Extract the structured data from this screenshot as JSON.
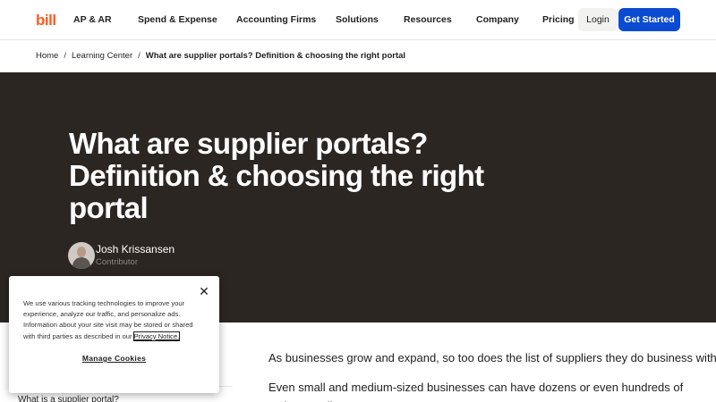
{
  "nav": {
    "logo": "bill",
    "links": [
      "AP & AR",
      "Spend & Expense",
      "Accounting Firms",
      "Solutions",
      "Resources",
      "Company",
      "Pricing"
    ],
    "login": "Login",
    "get_started": "Get Started"
  },
  "breadcrumb": {
    "home": "Home",
    "learning_center": "Learning Center",
    "current": "What are supplier portals? Definition & choosing the right portal",
    "separator": "/"
  },
  "hero": {
    "title": "What are supplier portals? Definition & choosing the right portal",
    "author_name": "Josh Krissansen",
    "author_role": "Contributor",
    "background": "#2c2623"
  },
  "article": {
    "p1": "As businesses grow and expand, so too does the list of suppliers they do business with.",
    "p2": "Even small and medium-sized businesses can have dozens or even hundreds of active suppliers."
  },
  "toc": {
    "first_item": "What is a supplier portal?"
  },
  "cookie_banner": {
    "text_before_link": "We use various tracking technologies to improve your experience, analyze our traffic, and personalize ads. Information about your site visit may be stored or shared with third parties as described in our ",
    "link_text": "Privacy Notice.",
    "manage": "Manage Cookies",
    "close_icon": "close-icon"
  },
  "colors": {
    "brand_orange": "#ff5a1f",
    "primary_blue": "#0b4bd1"
  }
}
